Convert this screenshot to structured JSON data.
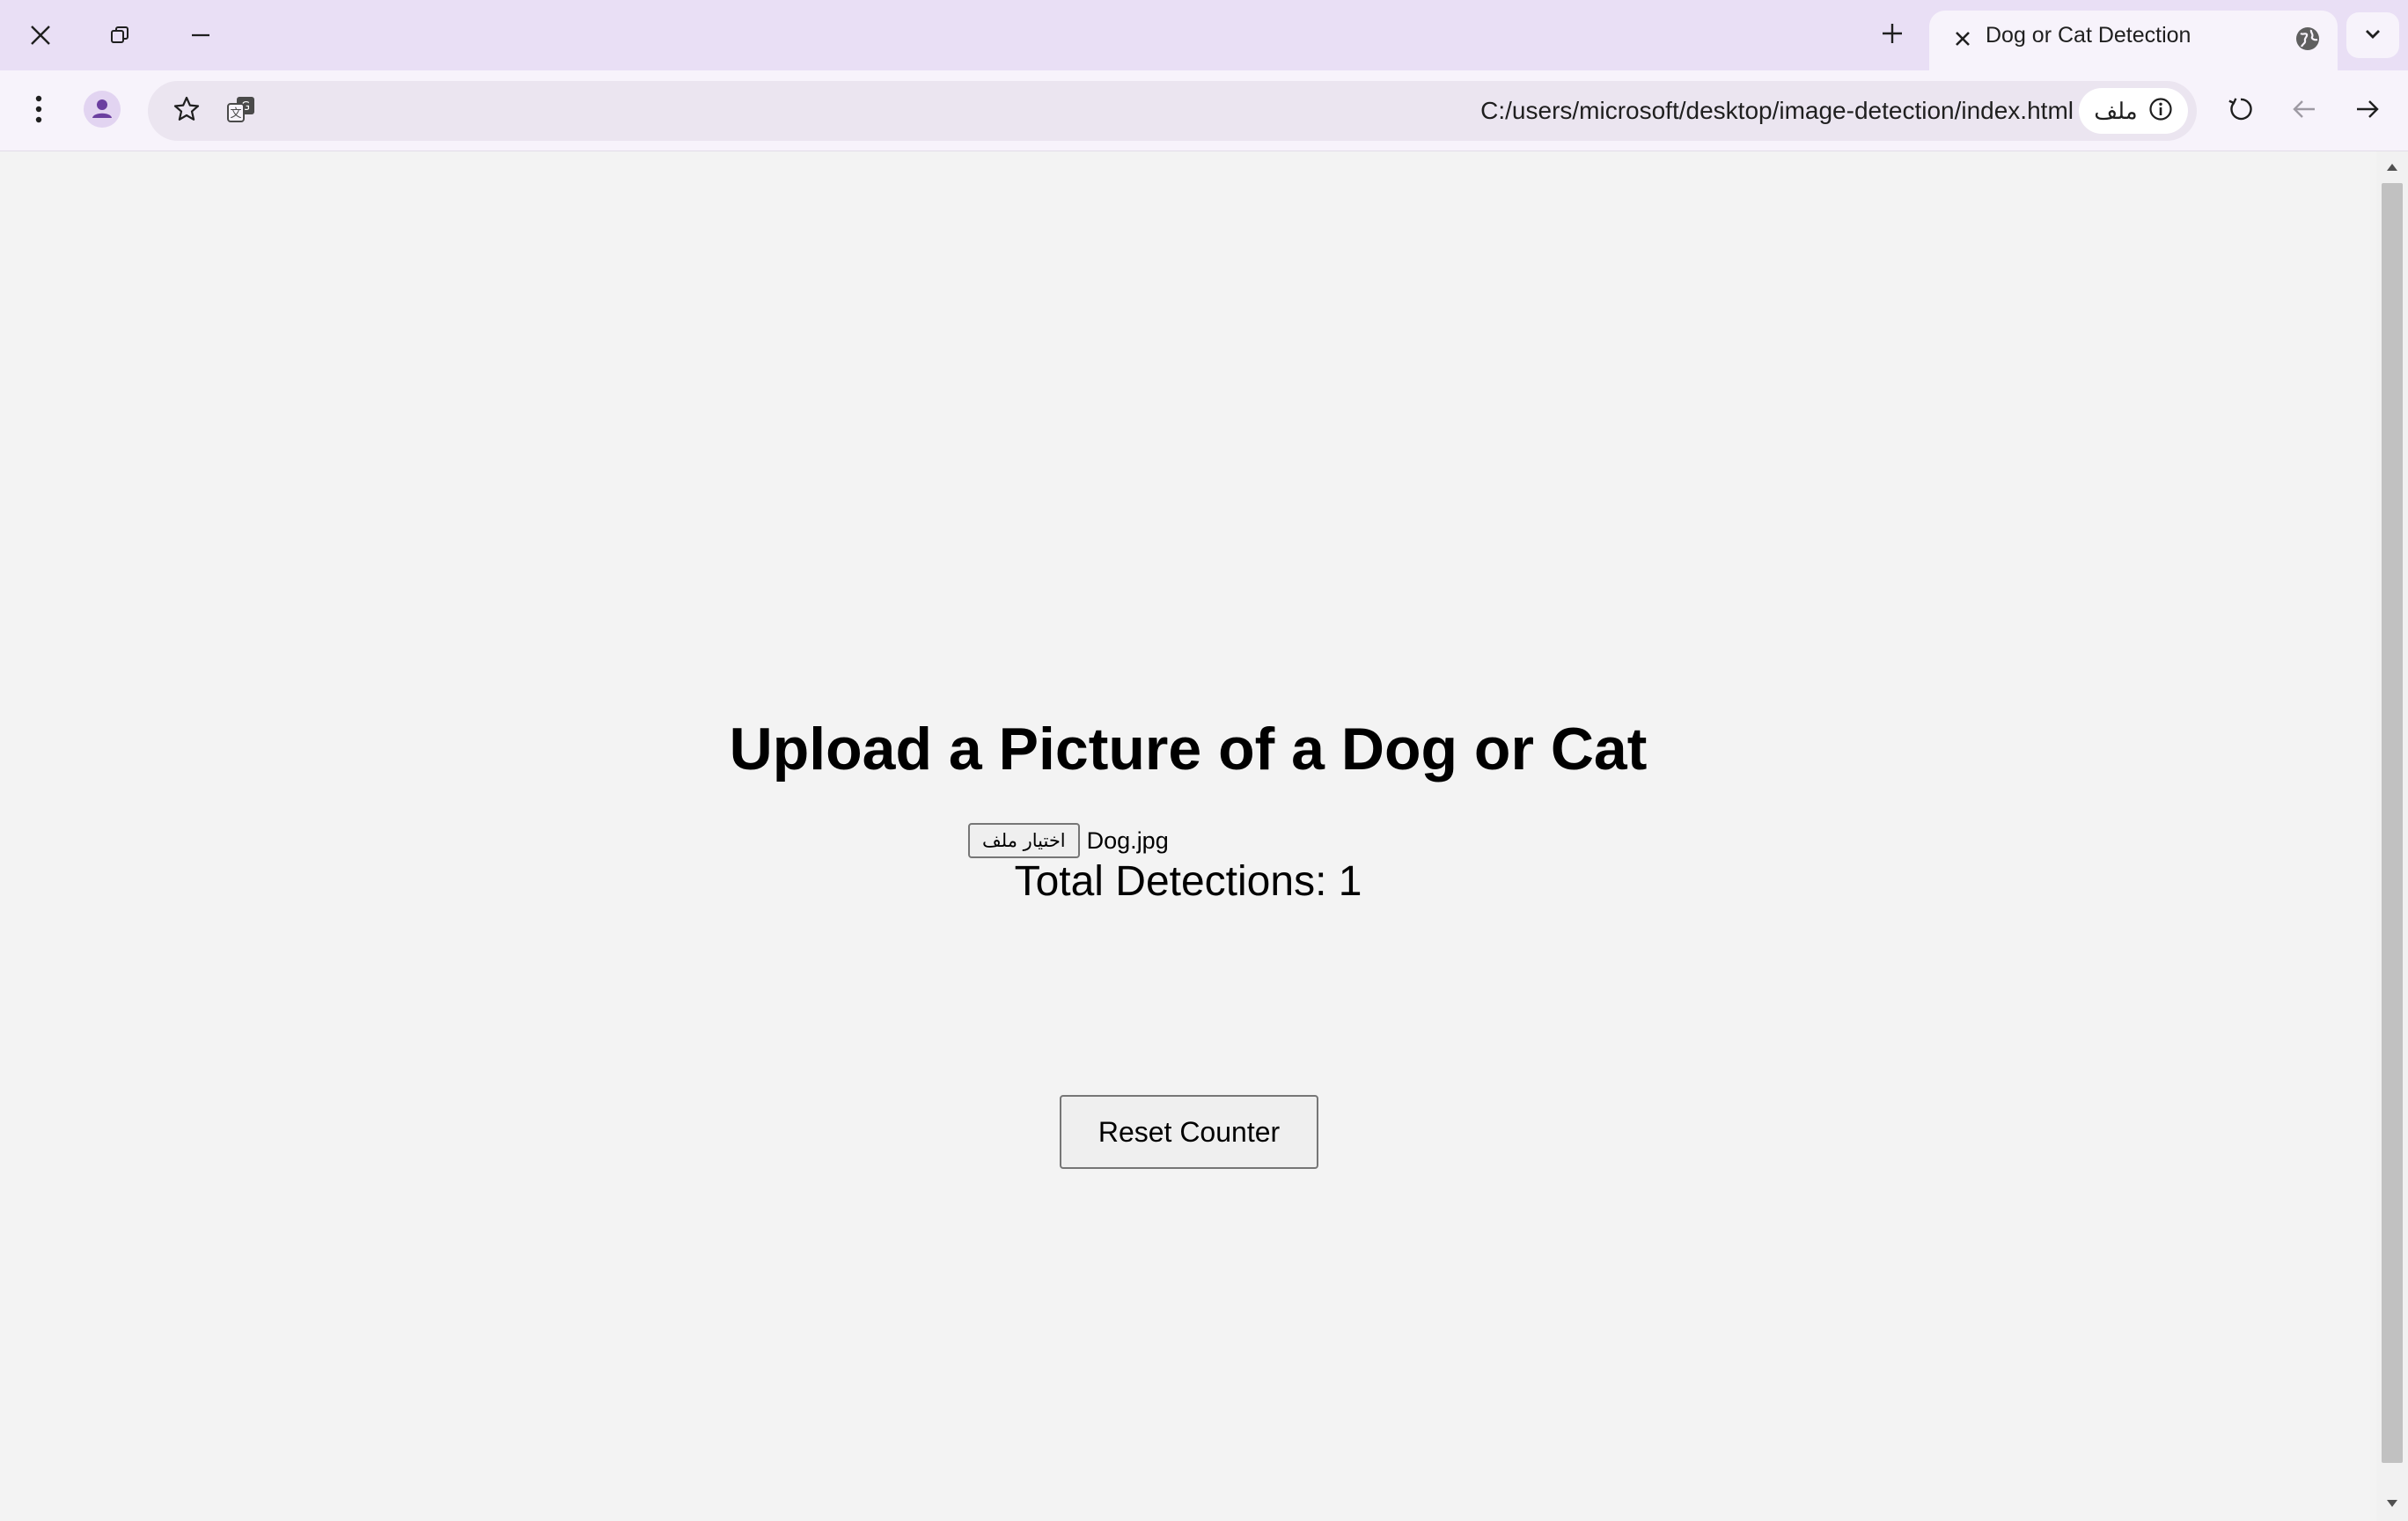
{
  "tab": {
    "title": "Dog or Cat Detection"
  },
  "address_bar": {
    "url": "C:/users/microsoft/desktop/image-detection/index.html",
    "site_chip_label": "ملف"
  },
  "page": {
    "heading": "Upload a Picture of a Dog or Cat",
    "file_input": {
      "button_label": "اختيار ملف",
      "selected_file": "Dog.jpg"
    },
    "counter": {
      "text": "Total Detections: 1",
      "value": 1
    },
    "reset_button_label": "Reset Counter"
  },
  "icons": {
    "window_close": "close-icon",
    "window_restore": "restore-icon",
    "window_minimize": "minimize-icon",
    "new_tab": "plus-icon",
    "tab_close": "close-icon",
    "tab_favicon": "globe-icon",
    "tab_list": "chevron-down-icon",
    "menu": "kebab-menu-icon",
    "profile": "profile-icon",
    "bookmark": "star-icon",
    "translate": "translate-icon",
    "site_info": "info-icon",
    "reload": "reload-icon",
    "back": "arrow-back-icon",
    "forward": "arrow-forward-icon"
  },
  "colors": {
    "tabstrip_bg": "#e9dff5",
    "toolbar_bg": "#f7f3fb",
    "omnibox_bg": "#ebe5f0",
    "page_bg": "#f3f3f3",
    "profile_accent": "#6b3fa0"
  }
}
